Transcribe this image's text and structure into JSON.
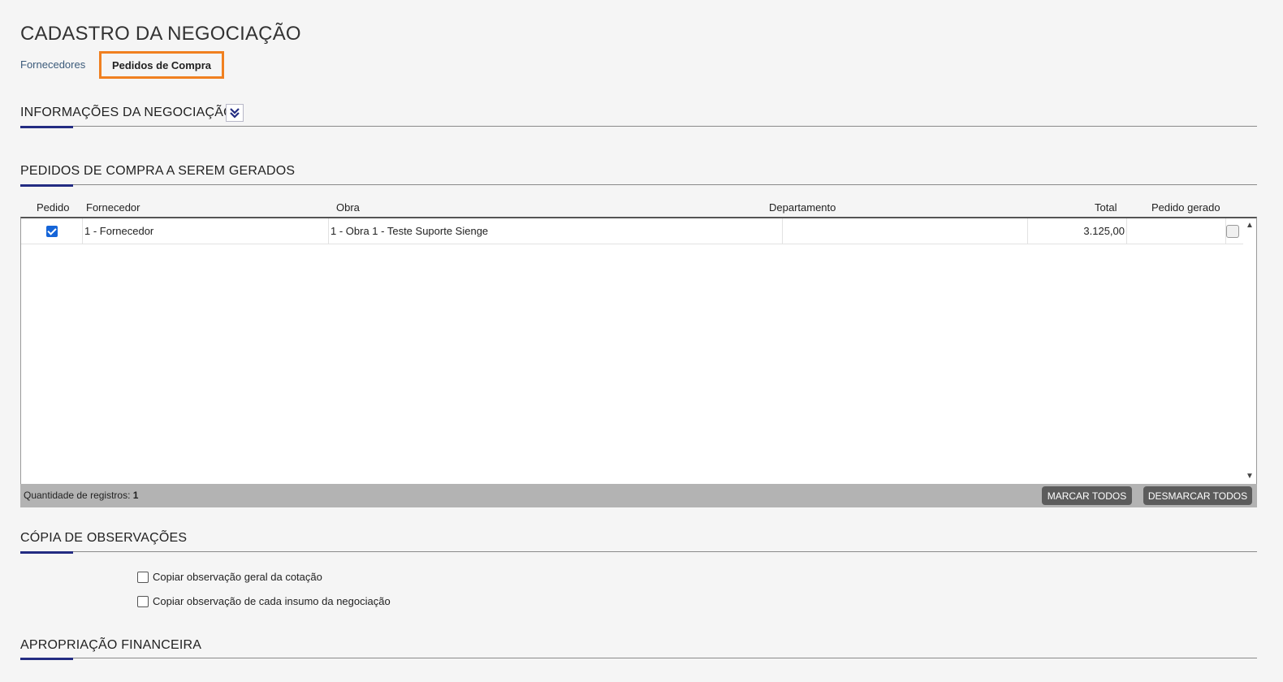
{
  "page": {
    "title": "CADASTRO DA NEGOCIAÇÃO"
  },
  "tabs": [
    {
      "label": "Fornecedores",
      "active": false
    },
    {
      "label": "Pedidos de Compra",
      "active": true
    }
  ],
  "sections": {
    "info": {
      "title": "INFORMAÇÕES DA NEGOCIAÇÃO",
      "expand_icon": "double-chevron-down-icon"
    },
    "orders": {
      "title": "PEDIDOS DE COMPRA A SEREM GERADOS"
    },
    "copy": {
      "title": "CÓPIA DE OBSERVAÇÕES"
    },
    "financial": {
      "title": "APROPRIAÇÃO FINANCEIRA"
    }
  },
  "table": {
    "columns": [
      "Pedido",
      "Fornecedor",
      "Obra",
      "Departamento",
      "Total",
      "Pedido gerado"
    ],
    "rows": [
      {
        "checked": true,
        "fornecedor": "1 - Fornecedor",
        "obra": "1 - Obra 1 - Teste Suporte Sienge",
        "departamento": "",
        "total": "3.125,00",
        "pedido_gerado": ""
      }
    ],
    "footer": {
      "count_label": "Quantidade de registros:",
      "count_value": "1",
      "mark_all": "MARCAR TODOS",
      "unmark_all": "DESMARCAR TODOS"
    }
  },
  "copy_options": [
    {
      "label": "Copiar observação geral da cotação",
      "checked": false
    },
    {
      "label": "Copiar observação de cada insumo da negociação",
      "checked": false
    }
  ],
  "colors": {
    "accent": "#232c82",
    "active_tab_border": "#f08020",
    "checkbox": "#1565d8"
  }
}
